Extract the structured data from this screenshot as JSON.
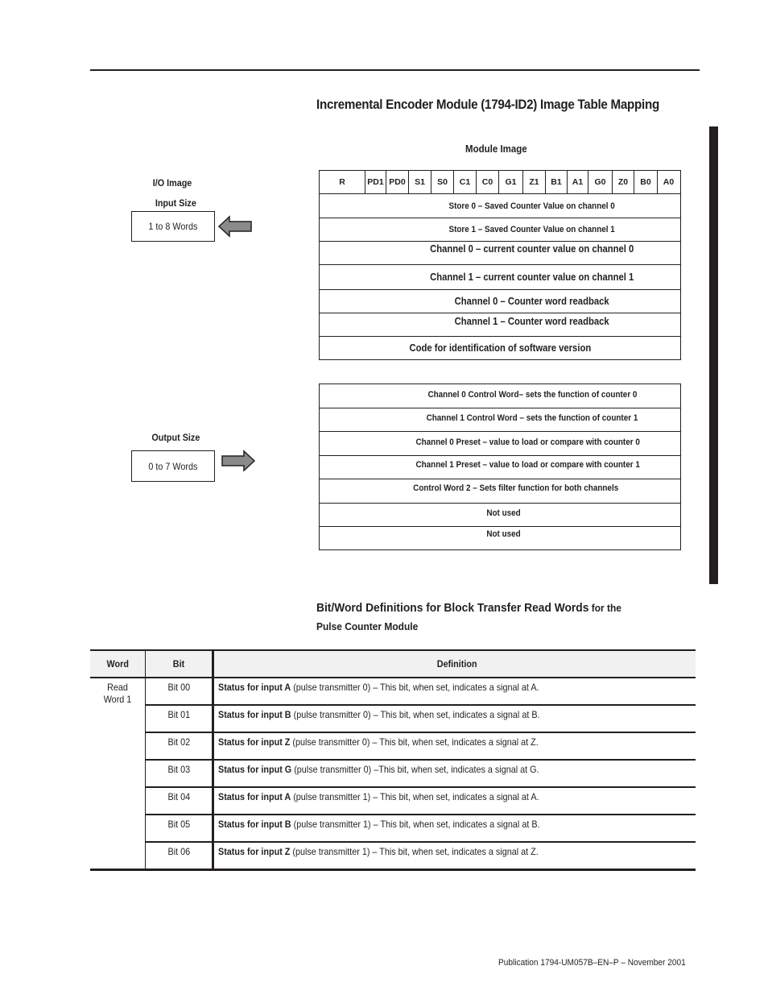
{
  "page": {
    "title": "Incremental Encoder Module (1794-ID2) Image Table Mapping",
    "footer": "Publication 1794-UM057B–EN–P – November 2001"
  },
  "io_image": {
    "heading": "I/O Image",
    "input_size_label": "Input Size",
    "input_size_value": "1 to 8 Words",
    "input_arrow_icon": "arrow-left-icon",
    "output_size_label": "Output Size",
    "output_size_value": "0 to 7 Words",
    "output_arrow_icon": "arrow-right-icon"
  },
  "module_image": {
    "label": "Module Image",
    "bits": [
      "R",
      "PD1",
      "PD0",
      "S1",
      "S0",
      "C1",
      "C0",
      "G1",
      "Z1",
      "B1",
      "A1",
      "G0",
      "Z0",
      "B0",
      "A0"
    ],
    "read_words": [
      "Store 0 – Saved Counter Value on channel 0",
      "Store 1 – Saved Counter Value on channel 1",
      "Channel 0 – current counter value on channel 0",
      "Channel 1 – current counter value on channel 1",
      "Channel 0 – Counter word readback",
      "Channel 1 – Counter word readback",
      "Code for identification of software version"
    ],
    "write_words": [
      "Channel 0 Control Word– sets the function of counter 0",
      "Channel 1 Control Word – sets the function of counter 1",
      "Channel 0 Preset – value to load or compare with counter 0",
      "Channel 1 Preset – value to load or compare with counter 1",
      "Control Word 2 – Sets filter function for both channels",
      "Not used",
      "Not used"
    ]
  },
  "definitions": {
    "heading_main": "Bit/Word Definitions for Block Transfer Read Words",
    "heading_tail": " for the",
    "heading_line2": "Pulse Counter Module",
    "columns": [
      "Word",
      "Bit",
      "Definition"
    ],
    "word": "Read Word 1",
    "rows": [
      {
        "bit": "Bit 00",
        "bold": "Status for input A",
        "text": " (pulse transmitter 0) – This bit, when set, indicates a signal at A."
      },
      {
        "bit": "Bit 01",
        "bold": "Status for input B",
        "text": " (pulse transmitter 0) – This bit, when set, indicates a signal at B."
      },
      {
        "bit": "Bit 02",
        "bold": "Status for input Z",
        "text": " (pulse transmitter 0) – This bit, when set, indicates a signal at Z."
      },
      {
        "bit": "Bit 03",
        "bold": "Status for input G",
        "text": " (pulse transmitter 0) –This bit, when set, indicates a signal at G."
      },
      {
        "bit": "Bit 04",
        "bold": "Status for input A",
        "text": " (pulse transmitter 1) – This bit, when set, indicates a signal at A."
      },
      {
        "bit": "Bit 05",
        "bold": "Status for input B",
        "text": " (pulse transmitter 1) – This bit, when set, indicates a signal at B."
      },
      {
        "bit": "Bit 06",
        "bold": "Status for input Z",
        "text": " (pulse transmitter 1) – This bit, when set, indicates a signal at Z."
      }
    ]
  }
}
